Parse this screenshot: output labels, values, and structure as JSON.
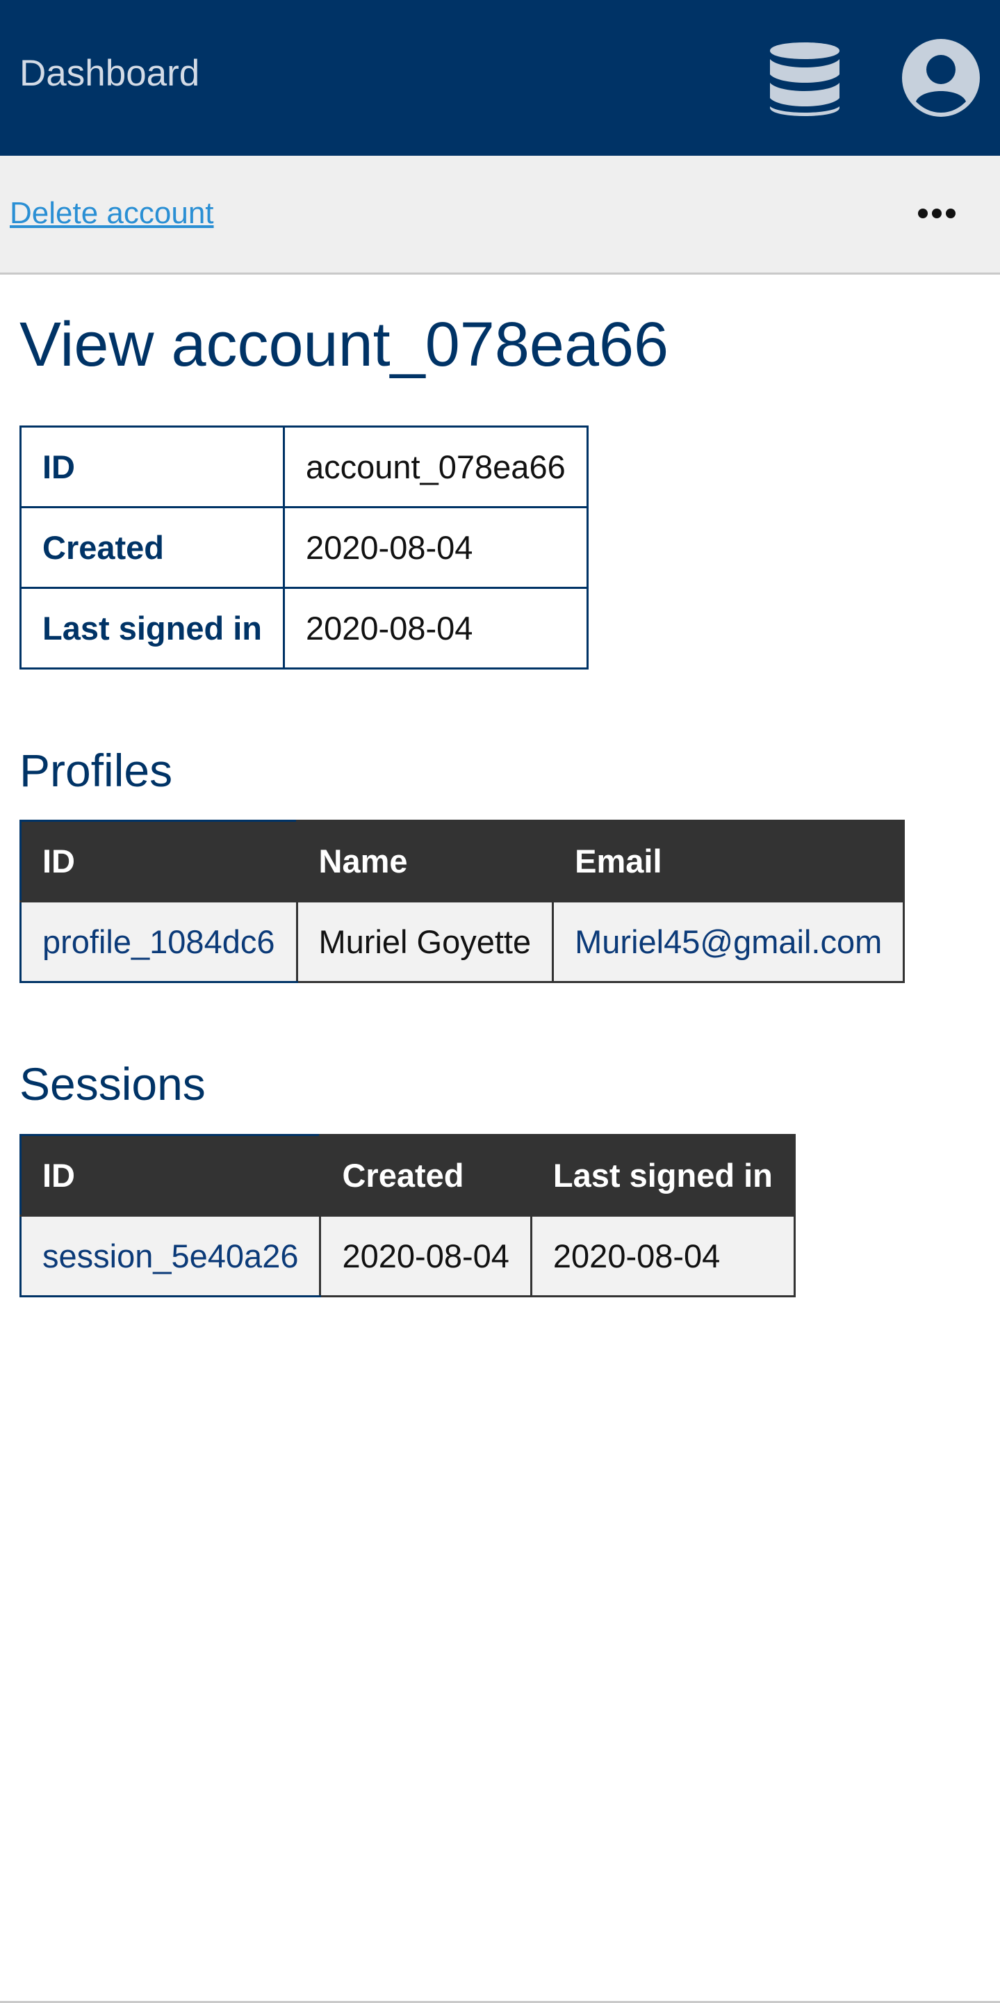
{
  "header": {
    "brand": "Dashboard",
    "icons": [
      "database-icon",
      "user-account-icon"
    ],
    "background_color": "#003366"
  },
  "actions": {
    "delete_label": "Delete account",
    "more_icon": "more-horizontal-icon"
  },
  "page": {
    "title": "View account_078ea66"
  },
  "details": {
    "rows": [
      {
        "key": "ID",
        "value": "account_078ea66"
      },
      {
        "key": "Created",
        "value": "2020-08-04"
      },
      {
        "key": "Last signed in",
        "value": "2020-08-04"
      }
    ]
  },
  "profiles": {
    "title": "Profiles",
    "columns": [
      "ID",
      "Name",
      "Email"
    ],
    "rows": [
      {
        "id": "profile_1084dc6",
        "name": "Muriel Goyette",
        "email": "Muriel45@gmail.com"
      }
    ]
  },
  "sessions": {
    "title": "Sessions",
    "columns": [
      "ID",
      "Created",
      "Last signed in"
    ],
    "rows": [
      {
        "id": "session_5e40a26",
        "created": "2020-08-04",
        "last_signed_in": "2020-08-04"
      }
    ]
  }
}
